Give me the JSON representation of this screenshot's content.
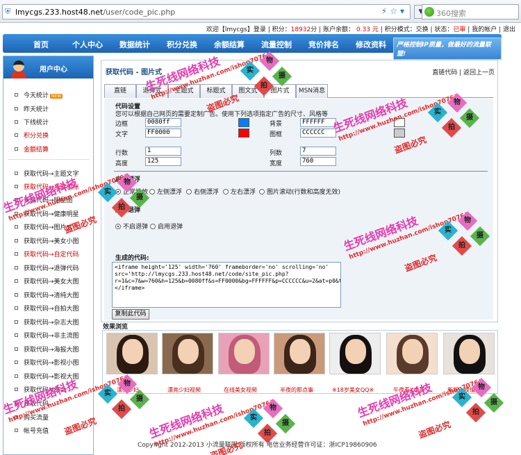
{
  "browser": {
    "url_host": "lmycgs.233.host48.net",
    "url_path": "/user/code_pic.php",
    "search_placeholder": "360搜索"
  },
  "topinfo": {
    "welcome": "欢迎【lmycgs】登录",
    "points_label": "积分：",
    "points": "18932",
    "points_unit": "分",
    "balance_label": "账户余额：",
    "balance": "0.33",
    "balance_unit": "元",
    "mode": "积分模式：交换",
    "status_label": "状态：",
    "status": "已审",
    "my_account": "我的帐户",
    "logout": "退出"
  },
  "nav": {
    "items": [
      "首页",
      "个人中心",
      "数据统计",
      "积分兑换",
      "余额结算",
      "流量控制",
      "竞价排名",
      "修改资料"
    ],
    "promo": "严格控制IP质量，做最好的流量联盟!"
  },
  "sidebar": {
    "title": "用户中心",
    "items": [
      {
        "label": "今天统计",
        "badge": "NEW"
      },
      {
        "label": "昨天统计"
      },
      {
        "label": "下线统计"
      },
      {
        "label": "积分兑换"
      },
      {
        "label": "金额结算"
      },
      {
        "label": "获取代码→主题文字"
      },
      {
        "label": "获取代码→左健频标"
      },
      {
        "label": "获取代码→明星图"
      },
      {
        "label": "获取代码→健康明星"
      },
      {
        "label": "获取代码→图片式"
      },
      {
        "label": "获取代码→美女小图"
      },
      {
        "label": "获取代码→自定代码"
      },
      {
        "label": "获取代码→退弹代码"
      },
      {
        "label": "获取代码→美女大图"
      },
      {
        "label": "获取代码→清纯大图"
      },
      {
        "label": "获取代码→自拍大图"
      },
      {
        "label": "获取代码→杂志大图"
      },
      {
        "label": "获取代码→非主流图"
      },
      {
        "label": "获取代码→海报大图"
      },
      {
        "label": "获取代码→影视小图"
      },
      {
        "label": "获取代码→影视大图"
      },
      {
        "label": "获取代码→综合"
      },
      {
        "label": "获取代码"
      },
      {
        "label": "购买流量"
      },
      {
        "label": "帐号充值"
      }
    ]
  },
  "main": {
    "title": "获取代码 - 图片式",
    "link_direct": "直链代码",
    "link_back": "返回上一页",
    "tabs": [
      "直链",
      "退弹式",
      "主题式",
      "标题式",
      "图文式",
      "图片式",
      "MSN消息"
    ],
    "settings_title": "代码设置",
    "settings_desc": "您可以根据自己网页的需要定制广告。使用下列选项指定广告的尺寸、风格等",
    "border_label": "边框",
    "border_value": "0080ff",
    "text_label": "文字",
    "text_value": "FF0000",
    "bg_label": "背景",
    "bg_value": "FFFFFF",
    "frame_label": "图框",
    "frame_value": "CCCCCC",
    "rows_label": "行数",
    "rows_value": "1",
    "cols_label": "列数",
    "cols_value": "7",
    "height_label": "高度",
    "height_value": "125",
    "width_label": "宽度",
    "width_value": "760",
    "float_title": "启用漂浮",
    "float_options": [
      "正常投放",
      "左侧漂浮",
      "右侧漂浮",
      "左右漂浮",
      "图片滚动(行数和高度无效)"
    ],
    "popup_title": "启用退弹",
    "popup_options": [
      "不启退弹",
      "启用退弹"
    ],
    "code_title": "生成的代码:",
    "code": "<iframe height='125' width='760' frameborder='no' scrolling='no' src='http://lmycgs.233.host48.net/code/site_pic.php?r=1&c=7&w=760&h=125&b=0080ff&s=FF0000&bg=FFFFFF&p=CCCCCC&u=2&at=p0&tt=tl'></iframe>",
    "copy_button": "复制此代码"
  },
  "preview": {
    "label": "效果浏览",
    "captions": [
      "漂亮少妇",
      "漂亮少妇视频",
      "在线美女视频",
      "半夜的那点事",
      "※18岁美女QQ※",
      "午夜看X电影",
      "新版一夜情交友"
    ]
  },
  "footer": "Copyright 2012-2013 小流量联盟 版权所有 电信业务经营许可证：浙ICP19860906",
  "watermark": {
    "cn": "生死线网络科技",
    "url": "http://www.huzhan.com/ishop7076/",
    "warn": "盗图必究",
    "chars": [
      "实",
      "物",
      "拍",
      "摄"
    ]
  },
  "colors": {
    "nav": "#1d63b4",
    "border_swatch": "#0080ff",
    "text_swatch": "#FF0000"
  }
}
